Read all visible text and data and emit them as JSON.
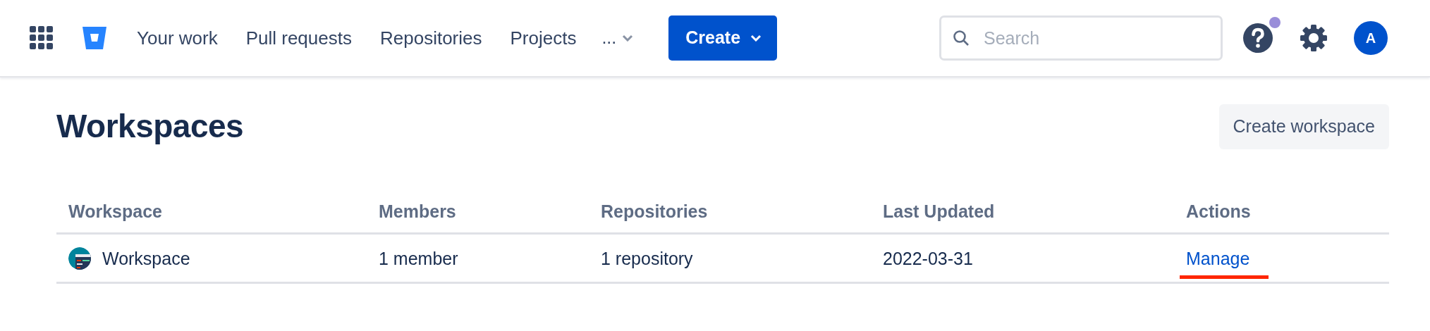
{
  "nav": {
    "items": [
      {
        "label": "Your work"
      },
      {
        "label": "Pull requests"
      },
      {
        "label": "Repositories"
      },
      {
        "label": "Projects"
      }
    ],
    "more": {
      "label": "..."
    },
    "create_button": {
      "label": "Create"
    },
    "search": {
      "placeholder": "Search"
    },
    "help": {
      "has_notification": true
    },
    "avatar": {
      "initial": "A"
    }
  },
  "page": {
    "title": "Workspaces",
    "create_button": {
      "label": "Create workspace"
    }
  },
  "table": {
    "columns": [
      "Workspace",
      "Members",
      "Repositories",
      "Last Updated",
      "Actions"
    ],
    "rows": [
      {
        "workspace": "Workspace",
        "members": "1 member",
        "repositories": "1 repository",
        "last_updated": "2022-03-31",
        "action": {
          "label": "Manage",
          "highlighted": true
        }
      }
    ]
  }
}
